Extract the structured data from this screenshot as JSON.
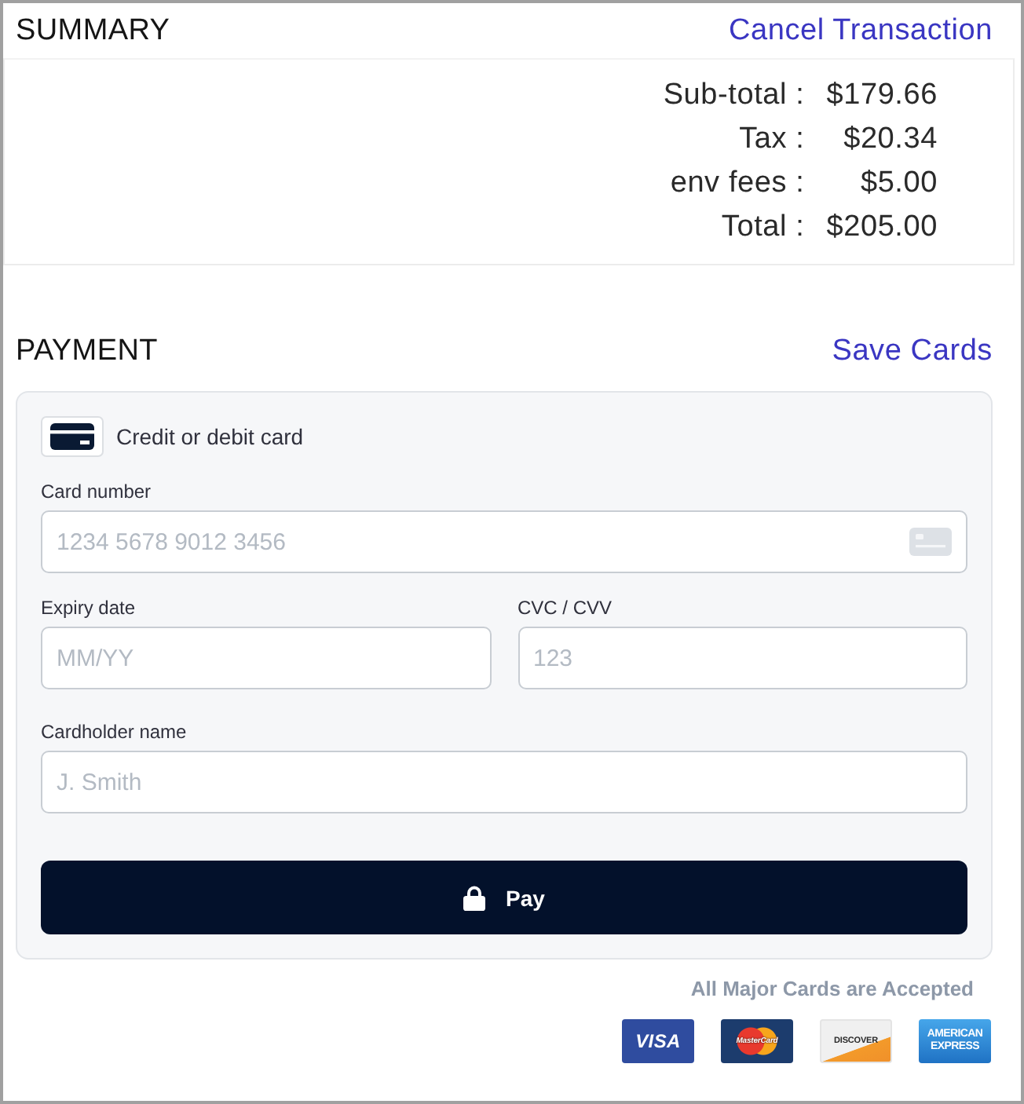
{
  "summary": {
    "title": "SUMMARY",
    "cancel_link": "Cancel Transaction",
    "rows": [
      {
        "label": "Sub-total :",
        "value": "$179.66"
      },
      {
        "label": "Tax :",
        "value": "$20.34"
      },
      {
        "label": "env fees :",
        "value": "$5.00"
      },
      {
        "label": "Total :",
        "value": "$205.00"
      }
    ]
  },
  "payment": {
    "title": "PAYMENT",
    "save_link": "Save Cards",
    "method": {
      "label": "Credit or debit card"
    },
    "field_rows": [
      {
        "fields": [
          {
            "label": "Card number",
            "placeholder": "1234 5678 9012 3456",
            "kind": "card"
          }
        ]
      },
      {
        "fields": [
          {
            "label": "Expiry date",
            "placeholder": "MM/YY",
            "kind": "text"
          },
          {
            "label": "CVC / CVV",
            "placeholder": "123",
            "kind": "text"
          }
        ]
      },
      {
        "fields": [
          {
            "label": "Cardholder name",
            "placeholder": "J. Smith",
            "kind": "text"
          }
        ]
      }
    ],
    "pay_button": "Pay"
  },
  "accepted": {
    "note": "All Major Cards are Accepted",
    "card_logos": [
      {
        "kind": "visa",
        "label": "VISA"
      },
      {
        "kind": "mastercard",
        "label": "MasterCard"
      },
      {
        "kind": "discover",
        "label": "DISCOVER"
      },
      {
        "kind": "amex",
        "label": "AMERICAN EXPRESS"
      }
    ]
  }
}
